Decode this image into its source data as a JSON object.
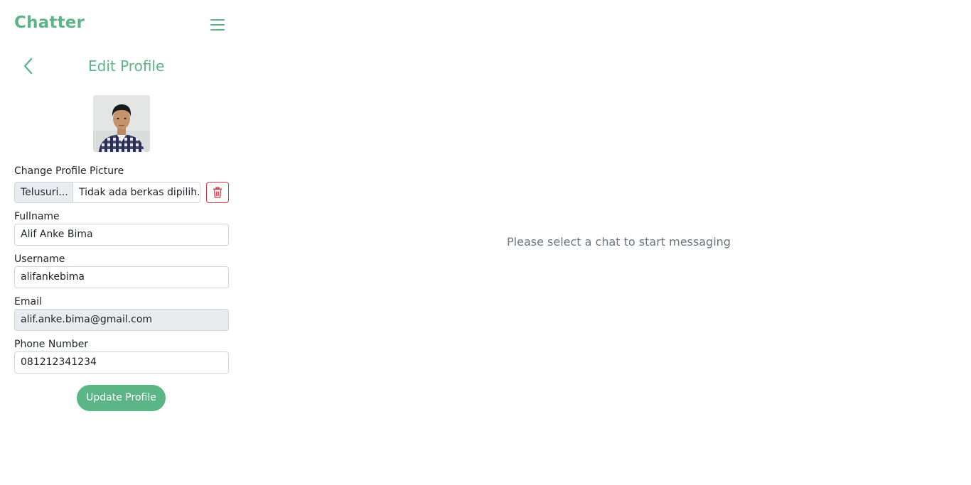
{
  "app": {
    "brand": "Chatter"
  },
  "colors": {
    "accent": "#5cb585",
    "danger": "#dc3545",
    "muted_text": "#6c757d"
  },
  "icons": {
    "menu": "hamburger-icon",
    "back": "chevron-left-icon",
    "delete": "trash-icon"
  },
  "profile": {
    "title": "Edit Profile",
    "picture_label": "Change Profile Picture",
    "file_button_label": "Telusuri...",
    "file_status": "Tidak ada berkas dipilih.",
    "fields": {
      "fullname": {
        "label": "Fullname",
        "value": "Alif Anke Bima"
      },
      "username": {
        "label": "Username",
        "value": "alifankebima"
      },
      "email": {
        "label": "Email",
        "value": "alif.anke.bima@gmail.com"
      },
      "phone": {
        "label": "Phone Number",
        "value": "081212341234"
      }
    },
    "submit_label": "Update Profile"
  },
  "main": {
    "empty_message": "Please select a chat to start messaging"
  }
}
